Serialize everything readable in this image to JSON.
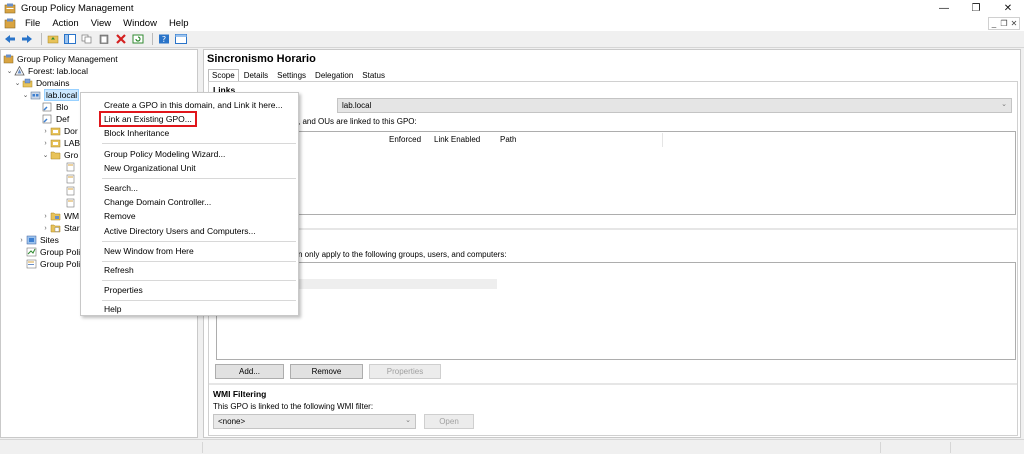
{
  "window": {
    "title": "Group Policy Management",
    "controls": {
      "minimize": "—",
      "restore": "❐",
      "close": "✕"
    }
  },
  "menubar": {
    "items": [
      "File",
      "Action",
      "View",
      "Window",
      "Help"
    ],
    "child_controls": {
      "minimize": "_",
      "restore": "❐",
      "close": "✕"
    }
  },
  "tree": {
    "items": [
      {
        "label": "Group Policy Management",
        "icon": "gpm-root-icon"
      },
      {
        "label": "Forest: lab.local",
        "icon": "forest-icon",
        "expander": "⌄"
      },
      {
        "label": "Domains",
        "icon": "domains-icon",
        "expander": "⌄"
      },
      {
        "label": "lab.local",
        "icon": "domain-icon",
        "expander": "⌄"
      },
      {
        "label": "Blo",
        "icon": "gpo-link-icon"
      },
      {
        "label": "Def",
        "icon": "gpo-link-icon"
      },
      {
        "label": "Dor",
        "icon": "ou-icon",
        "expander": "›"
      },
      {
        "label": "LAB",
        "icon": "ou-icon",
        "expander": "›"
      },
      {
        "label": "Gro",
        "icon": "gpo-folder-icon",
        "expander": "⌄"
      },
      {
        "label": "",
        "icon": "gpo-icon"
      },
      {
        "label": "",
        "icon": "gpo-icon"
      },
      {
        "label": "",
        "icon": "gpo-icon"
      },
      {
        "label": "",
        "icon": "gpo-icon"
      },
      {
        "label": "WM",
        "icon": "wmi-folder-icon",
        "expander": "›"
      },
      {
        "label": "Star",
        "icon": "starter-gpo-icon",
        "expander": "›"
      },
      {
        "label": "Sites",
        "icon": "sites-icon",
        "expander": "›"
      },
      {
        "label": "Group Polic",
        "icon": "modeling-icon"
      },
      {
        "label": "Group Polic",
        "icon": "results-icon"
      }
    ]
  },
  "context_menu": {
    "items": [
      "Create a GPO in this domain, and Link it here...",
      "Link an Existing GPO...",
      "Block Inheritance",
      "Group Policy Modeling Wizard...",
      "New Organizational Unit",
      "Search...",
      "Change Domain Controller...",
      "Remove",
      "Active Directory Users and Computers...",
      "New Window from Here",
      "Refresh",
      "Properties",
      "Help"
    ],
    "highlight_color": "#e0161b"
  },
  "details": {
    "title": "Sincronismo Horario",
    "tabs": [
      "Scope",
      "Details",
      "Settings",
      "Delegation",
      "Status"
    ],
    "links": {
      "heading": "Links",
      "location_value": "lab.local",
      "linked_text": ", and OUs are linked to this GPO:",
      "columns": [
        "Enforced",
        "Link Enabled",
        "Path"
      ]
    },
    "security": {
      "text": "n only apply to the following groups, users, and computers:",
      "buttons": {
        "add": "Add...",
        "remove": "Remove",
        "properties": "Properties"
      }
    },
    "wmi": {
      "heading": "WMI Filtering",
      "text": "This GPO is linked to the following WMI filter:",
      "filter_value": "<none>",
      "open_button": "Open"
    }
  },
  "colors": {
    "selection": "#cce8ff",
    "window_bg": "#f0f0f0"
  }
}
